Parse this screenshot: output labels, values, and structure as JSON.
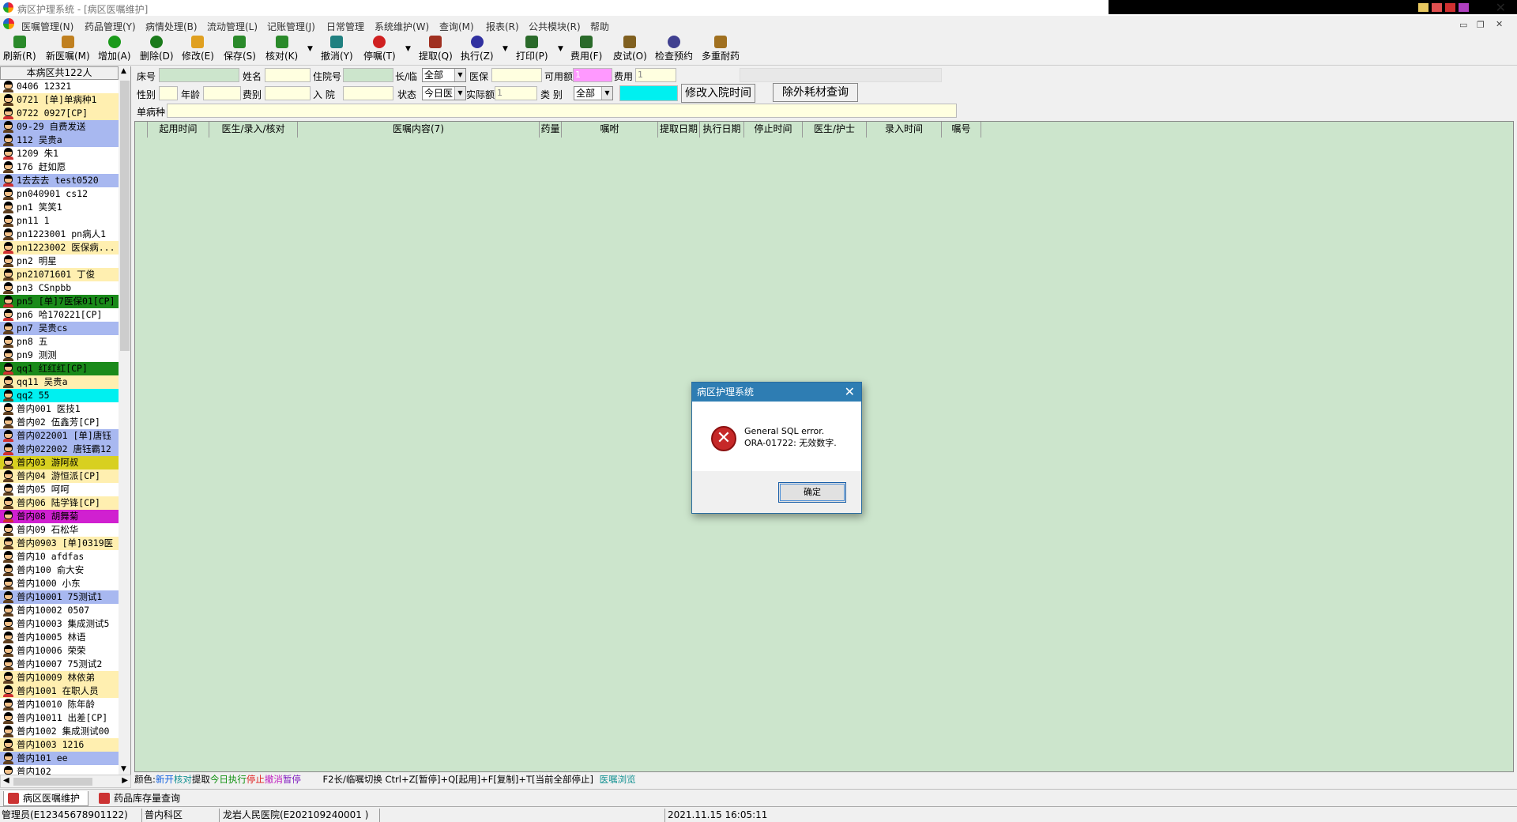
{
  "window": {
    "title": "病区护理系统 - [病区医嘱维护]"
  },
  "menu": [
    "医嘱管理(N)",
    "药品管理(Y)",
    "病情处理(B)",
    "流动管理(L)",
    "记账管理(J)",
    "日常管理",
    "系统维护(W)",
    "查询(M)",
    "报表(R)",
    "公共模块(R)",
    "帮助"
  ],
  "toolbar": [
    {
      "label": "刷新(R)",
      "icon": "refresh-icon",
      "color": "#2a8a2a"
    },
    {
      "label": "新医嘱(M)",
      "icon": "new-order-icon",
      "color": "#c08020"
    },
    {
      "label": "增加(A)",
      "icon": "add-icon",
      "color": "#1a9a1a"
    },
    {
      "label": "删除(D)",
      "icon": "delete-icon",
      "color": "#1a7a1a"
    },
    {
      "label": "修改(E)",
      "icon": "edit-icon",
      "color": "#e0a020"
    },
    {
      "label": "保存(S)",
      "icon": "save-icon",
      "color": "#2a8a2a"
    },
    {
      "label": "核对(K)",
      "icon": "check-icon",
      "color": "#2a8a2a"
    },
    {
      "label": "撤消(Y)",
      "icon": "undo-icon",
      "color": "#208080"
    },
    {
      "label": "停嘱(T)",
      "icon": "stop-icon",
      "color": "#d02020"
    },
    {
      "label": "提取(Q)",
      "icon": "extract-icon",
      "color": "#a03020"
    },
    {
      "label": "执行(Z)",
      "icon": "execute-icon",
      "color": "#3030a0"
    },
    {
      "label": "打印(P)",
      "icon": "print-icon",
      "color": "#2a6a2a"
    },
    {
      "label": "费用(F)",
      "icon": "fee-icon",
      "color": "#2a6a2a"
    },
    {
      "label": "皮试(O)",
      "icon": "skin-test-icon",
      "color": "#806020"
    },
    {
      "label": "检查预约",
      "icon": "appointment-icon",
      "color": "#404090"
    },
    {
      "label": "多重耐药",
      "icon": "resistance-icon",
      "color": "#a07020"
    }
  ],
  "patients": {
    "header": "本病区共122人",
    "rows": [
      {
        "text": "0406  12321",
        "bg": "#ffffff",
        "g": "m"
      },
      {
        "text": "0721 [单]单病种1",
        "bg": "#ffefb0",
        "g": "m"
      },
      {
        "text": "0722  0927[CP]",
        "bg": "#ffefb0",
        "g": "f"
      },
      {
        "text": "09-29 自费发送",
        "bg": "#a8b8f0",
        "g": "m"
      },
      {
        "text": "112  吴贵a",
        "bg": "#a8b8f0",
        "g": "m"
      },
      {
        "text": "1209 朱1",
        "bg": "#ffffff",
        "g": "f"
      },
      {
        "text": "176  赶如愿",
        "bg": "#ffffff",
        "g": "m"
      },
      {
        "text": "1去去去 test0520",
        "bg": "#a8b8f0",
        "g": "f"
      },
      {
        "text": "pn040901 cs12",
        "bg": "#ffffff",
        "g": "m"
      },
      {
        "text": "pn1  笑笑1",
        "bg": "#ffffff",
        "g": "m"
      },
      {
        "text": "pn11 1",
        "bg": "#ffffff",
        "g": "m"
      },
      {
        "text": "pn1223001 pn病人1",
        "bg": "#ffffff",
        "g": "m"
      },
      {
        "text": "pn1223002 医保病...",
        "bg": "#ffefb0",
        "g": "f"
      },
      {
        "text": "pn2  明星",
        "bg": "#ffffff",
        "g": "m"
      },
      {
        "text": "pn21071601 丁俊",
        "bg": "#ffefb0",
        "g": "m"
      },
      {
        "text": "pn3  CSnpbb",
        "bg": "#ffffff",
        "g": "m"
      },
      {
        "text": "pn5  [单]7医保01[CP]",
        "bg": "#1a8a1a",
        "g": "f"
      },
      {
        "text": "pn6  哈170221[CP]",
        "bg": "#ffffff",
        "g": "f"
      },
      {
        "text": "pn7  吴贵cs",
        "bg": "#a8b8f0",
        "g": "m"
      },
      {
        "text": "pn8  五",
        "bg": "#ffffff",
        "g": "m"
      },
      {
        "text": "pn9  测测",
        "bg": "#ffffff",
        "g": "m"
      },
      {
        "text": "qq1  红红红[CP]",
        "bg": "#1a8a1a",
        "g": "f"
      },
      {
        "text": "qq11 吴贵a",
        "bg": "#ffefb0",
        "g": "m"
      },
      {
        "text": "qq2  55",
        "bg": "#00f0f0",
        "g": "m"
      },
      {
        "text": "普内001 医技1",
        "bg": "#ffffff",
        "g": "m"
      },
      {
        "text": "普内02 伍鑫芳[CP]",
        "bg": "#ffffff",
        "g": "m"
      },
      {
        "text": "普内022001 [单]唐钰",
        "bg": "#a8b8f0",
        "g": "f"
      },
      {
        "text": "普内022002 唐钰霸12",
        "bg": "#a8b8f0",
        "g": "f"
      },
      {
        "text": "普内03 游阿叔",
        "bg": "#d8d020",
        "g": "m"
      },
      {
        "text": "普内04 游恒派[CP]",
        "bg": "#ffefb0",
        "g": "m"
      },
      {
        "text": "普内05 呵呵",
        "bg": "#ffffff",
        "g": "m"
      },
      {
        "text": "普内06 陆学锋[CP]",
        "bg": "#ffefb0",
        "g": "m"
      },
      {
        "text": "普内08 胡舞菊",
        "bg": "#d020d0",
        "g": "f"
      },
      {
        "text": "普内09 石松华",
        "bg": "#ffffff",
        "g": "m"
      },
      {
        "text": "普内0903 [单]0319医",
        "bg": "#ffefb0",
        "g": "m"
      },
      {
        "text": "普内10 afdfas",
        "bg": "#ffffff",
        "g": "m"
      },
      {
        "text": "普内100 俞大安",
        "bg": "#ffffff",
        "g": "m"
      },
      {
        "text": "普内1000 小东",
        "bg": "#ffffff",
        "g": "m"
      },
      {
        "text": "普内10001 75测试1",
        "bg": "#a8b8f0",
        "g": "m"
      },
      {
        "text": "普内10002 0507",
        "bg": "#ffffff",
        "g": "m"
      },
      {
        "text": "普内10003 集成测试5",
        "bg": "#ffffff",
        "g": "m"
      },
      {
        "text": "普内10005 林语",
        "bg": "#ffffff",
        "g": "m"
      },
      {
        "text": "普内10006 荣荣",
        "bg": "#ffffff",
        "g": "m"
      },
      {
        "text": "普内10007 75测试2",
        "bg": "#ffffff",
        "g": "m"
      },
      {
        "text": "普内10009 林依弟",
        "bg": "#ffefb0",
        "g": "m"
      },
      {
        "text": "普内1001 在职人员",
        "bg": "#ffefb0",
        "g": "f"
      },
      {
        "text": "普内10010 陈年龄",
        "bg": "#ffffff",
        "g": "m"
      },
      {
        "text": "普内10011 出差[CP]",
        "bg": "#ffffff",
        "g": "m"
      },
      {
        "text": "普内1002 集成测试00",
        "bg": "#ffffff",
        "g": "m"
      },
      {
        "text": "普内1003 1216",
        "bg": "#ffefb0",
        "g": "m"
      },
      {
        "text": "普内101 ee",
        "bg": "#a8b8f0",
        "g": "m"
      },
      {
        "text": "普内102",
        "bg": "#ffffff",
        "g": "m"
      }
    ]
  },
  "form": {
    "bed_label": "床号",
    "name_label": "姓名",
    "inpatient_no_label": "住院号",
    "long_temp_label": "长/临",
    "long_temp_value": "全部",
    "insurance_label": "医保",
    "available_label": "可用额",
    "available_value": "1",
    "fee_label": "费用",
    "fee_value": "1",
    "sex_label": "性别",
    "age_label": "年龄",
    "fee_type_label": "费别",
    "admit_label": "入 院",
    "status_label": "状态",
    "status_value": "今日医",
    "actual_label": "实际额",
    "actual_value": "1",
    "category_label": "类  别",
    "category_value": "全部",
    "btn_modify": "修改入院时间",
    "btn_query": "除外耗材查询",
    "disease_label": "单病种"
  },
  "grid_columns": [
    "起用时间",
    "医生/录入/核对",
    "医嘱内容(7)",
    "药量",
    "嘱咐",
    "提取日期",
    "执行日期",
    "停止时间",
    "医生/护士",
    "录入时间",
    "嘱号"
  ],
  "colorbar": {
    "label": "颜色:",
    "items": [
      {
        "t": "新开",
        "c": "#1060e0"
      },
      {
        "t": "核对",
        "c": "#109090"
      },
      {
        "t": "提取",
        "c": "#000000"
      },
      {
        "t": "今日执行",
        "c": "#109010"
      },
      {
        "t": "停止",
        "c": "#e02020"
      },
      {
        "t": "撤消",
        "c": "#c020c0"
      },
      {
        "t": "暂停",
        "c": "#8020c0"
      }
    ],
    "shortcuts": "F2长/临嘱切换  Ctrl+Z[暂停]+Q[起用]+F[复制]+T[当前全部停止]",
    "browse": "医嘱浏览"
  },
  "tabs": [
    "病区医嘱维护",
    "药品库存量查询"
  ],
  "status": [
    "管理员(E12345678901122)",
    "普内科区",
    "龙岩人民医院(E202109240001 )",
    "",
    "2021.11.15 16:05:11"
  ],
  "dialog": {
    "title": "病区护理系统",
    "line1": "General SQL error.",
    "line2": "ORA-01722: 无效数字.",
    "ok": "确定"
  }
}
